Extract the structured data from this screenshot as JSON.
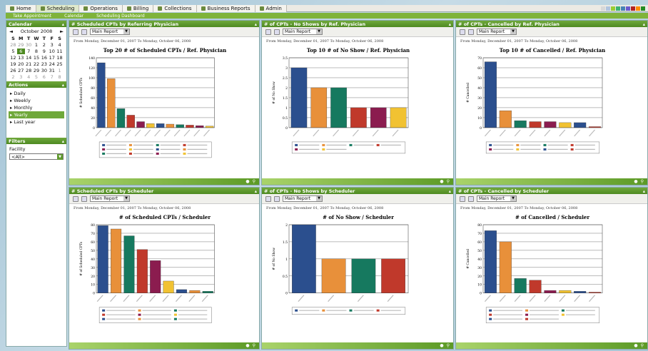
{
  "nav": {
    "tabs": [
      {
        "label": "Home",
        "icon": "home-icon"
      },
      {
        "label": "Scheduling",
        "icon": "calendar-icon",
        "active": true
      },
      {
        "label": "Operations",
        "icon": "operations-icon"
      },
      {
        "label": "Billing",
        "icon": "billing-icon"
      },
      {
        "label": "Collections",
        "icon": "collections-icon"
      },
      {
        "label": "Business Reports",
        "icon": "reports-icon"
      },
      {
        "label": "Admin",
        "icon": "admin-icon"
      }
    ],
    "sub_tabs": [
      "Take Appointment",
      "Calendar",
      "Scheduling Dashboard"
    ],
    "swatch_colors": [
      "#d8d8d8",
      "#b0c4de",
      "#9acd32",
      "#3cb371",
      "#4682b4",
      "#6a5acd",
      "#b22222",
      "#ff8c00",
      "#228b22"
    ]
  },
  "sidebar": {
    "calendar_title": "Calendar",
    "month": "October 2008",
    "prev": "◄",
    "next": "►",
    "dow": [
      "S",
      "M",
      "T",
      "W",
      "T",
      "F",
      "S"
    ],
    "weeks": [
      [
        "28",
        "29",
        "30",
        "1",
        "2",
        "3",
        "4"
      ],
      [
        "5",
        "6",
        "7",
        "8",
        "9",
        "10",
        "11"
      ],
      [
        "12",
        "13",
        "14",
        "15",
        "16",
        "17",
        "18"
      ],
      [
        "19",
        "20",
        "21",
        "22",
        "23",
        "24",
        "25"
      ],
      [
        "26",
        "27",
        "28",
        "29",
        "30",
        "31",
        "1"
      ],
      [
        "2",
        "3",
        "4",
        "5",
        "6",
        "7",
        "8"
      ]
    ],
    "actions_title": "Actions",
    "actions": [
      "Daily",
      "Weekly",
      "Monthly",
      "Yearly",
      "Last year"
    ],
    "filters_title": "Filters",
    "facility_label": "Facility",
    "facility_value": "<All>"
  },
  "report_label": "Main Report",
  "panels": [
    {
      "title": "# Scheduled CPTs by Referring Physician",
      "range": "From Monday, December 01, 2007 To Monday, October 06, 2008",
      "chart_data": {
        "type": "bar",
        "title": "Top 20 # of Scheduled CPTs / Ref. Physician",
        "ylabel": "# Scheduled CPTs",
        "ylim": [
          0,
          140
        ],
        "yticks": [
          0,
          20,
          40,
          60,
          80,
          100,
          120,
          140
        ],
        "values": [
          130,
          98,
          38,
          25,
          12,
          8,
          8,
          7,
          6,
          5,
          4,
          3
        ],
        "colors": [
          "#2b4f8e",
          "#e8903a",
          "#16795f",
          "#c0392b",
          "#8b1c4f",
          "#f1c232",
          "#2b4f8e",
          "#e8903a",
          "#16795f",
          "#c0392b",
          "#8b1c4f",
          "#f1c232"
        ],
        "legend_cols": 4
      }
    },
    {
      "title": "# of CPTs - No Shows by Ref. Physician",
      "range": "From Monday, December 01, 2007 To Monday, October 06, 2008",
      "chart_data": {
        "type": "bar",
        "title": "Top 10 # of No Show / Ref. Physician",
        "ylabel": "# of No Show",
        "ylim": [
          0,
          3.5
        ],
        "yticks": [
          0,
          0.5,
          1,
          1.5,
          2,
          2.5,
          3,
          3.5
        ],
        "values": [
          3,
          2,
          2,
          1,
          1,
          1
        ],
        "colors": [
          "#2b4f8e",
          "#e8903a",
          "#16795f",
          "#c0392b",
          "#8b1c4f",
          "#f1c232"
        ],
        "legend_cols": 4
      }
    },
    {
      "title": "# of CPTs - Cancelled by Ref. Physician",
      "range": "From Monday, December 01, 2007 To Monday, October 06, 2008",
      "chart_data": {
        "type": "bar",
        "title": "Top 10 # of Cancelled / Ref. Physician",
        "ylabel": "# Cancelled",
        "ylim": [
          0,
          70
        ],
        "yticks": [
          0,
          10,
          20,
          30,
          40,
          50,
          60,
          70
        ],
        "values": [
          66,
          17,
          7,
          6,
          6,
          5,
          5,
          1
        ],
        "colors": [
          "#2b4f8e",
          "#e8903a",
          "#16795f",
          "#c0392b",
          "#8b1c4f",
          "#f1c232",
          "#2b4f8e",
          "#c0392b"
        ],
        "legend_cols": 4
      }
    },
    {
      "title": "# Scheduled CPTs by Scheduler",
      "range": "From Monday, December 01, 2007 To Monday, October 06, 2008",
      "chart_data": {
        "type": "bar",
        "title": "# of Scheduled CPTs / Scheduler",
        "ylabel": "# of Scheduled CPTs",
        "ylim": [
          0,
          80
        ],
        "yticks": [
          0,
          10,
          20,
          30,
          40,
          50,
          60,
          70,
          80
        ],
        "values": [
          79,
          75,
          67,
          51,
          38,
          14,
          4,
          3,
          2
        ],
        "colors": [
          "#2b4f8e",
          "#e8903a",
          "#16795f",
          "#c0392b",
          "#8b1c4f",
          "#f1c232",
          "#2b4f8e",
          "#e8903a",
          "#16795f"
        ],
        "legend_cols": 3
      }
    },
    {
      "title": "# of CPTs - No Shows by Scheduler",
      "range": "From Monday, December 01, 2007 To Monday, October 06, 2008",
      "chart_data": {
        "type": "bar",
        "title": "# of No Show / Scheduler",
        "ylabel": "# of No Show",
        "ylim": [
          0,
          2
        ],
        "yticks": [
          0,
          0.5,
          1,
          1.5,
          2
        ],
        "values": [
          2,
          1,
          1,
          1
        ],
        "colors": [
          "#2b4f8e",
          "#e8903a",
          "#16795f",
          "#c0392b"
        ],
        "legend_cols": 4
      }
    },
    {
      "title": "# of CPTs - Cancelled by Scheduler",
      "range": "From Monday, December 01, 2007 To Monday, October 06, 2008",
      "chart_data": {
        "type": "bar",
        "title": "# of Cancelled / Scheduler",
        "ylabel": "# Cancelled",
        "ylim": [
          0,
          80
        ],
        "yticks": [
          0,
          10,
          20,
          30,
          40,
          50,
          60,
          70,
          80
        ],
        "values": [
          73,
          60,
          17,
          15,
          3,
          3,
          2,
          1
        ],
        "colors": [
          "#2b4f8e",
          "#e8903a",
          "#16795f",
          "#c0392b",
          "#8b1c4f",
          "#f1c232",
          "#2b4f8e",
          "#c0392b"
        ],
        "legend_cols": 3
      }
    }
  ]
}
